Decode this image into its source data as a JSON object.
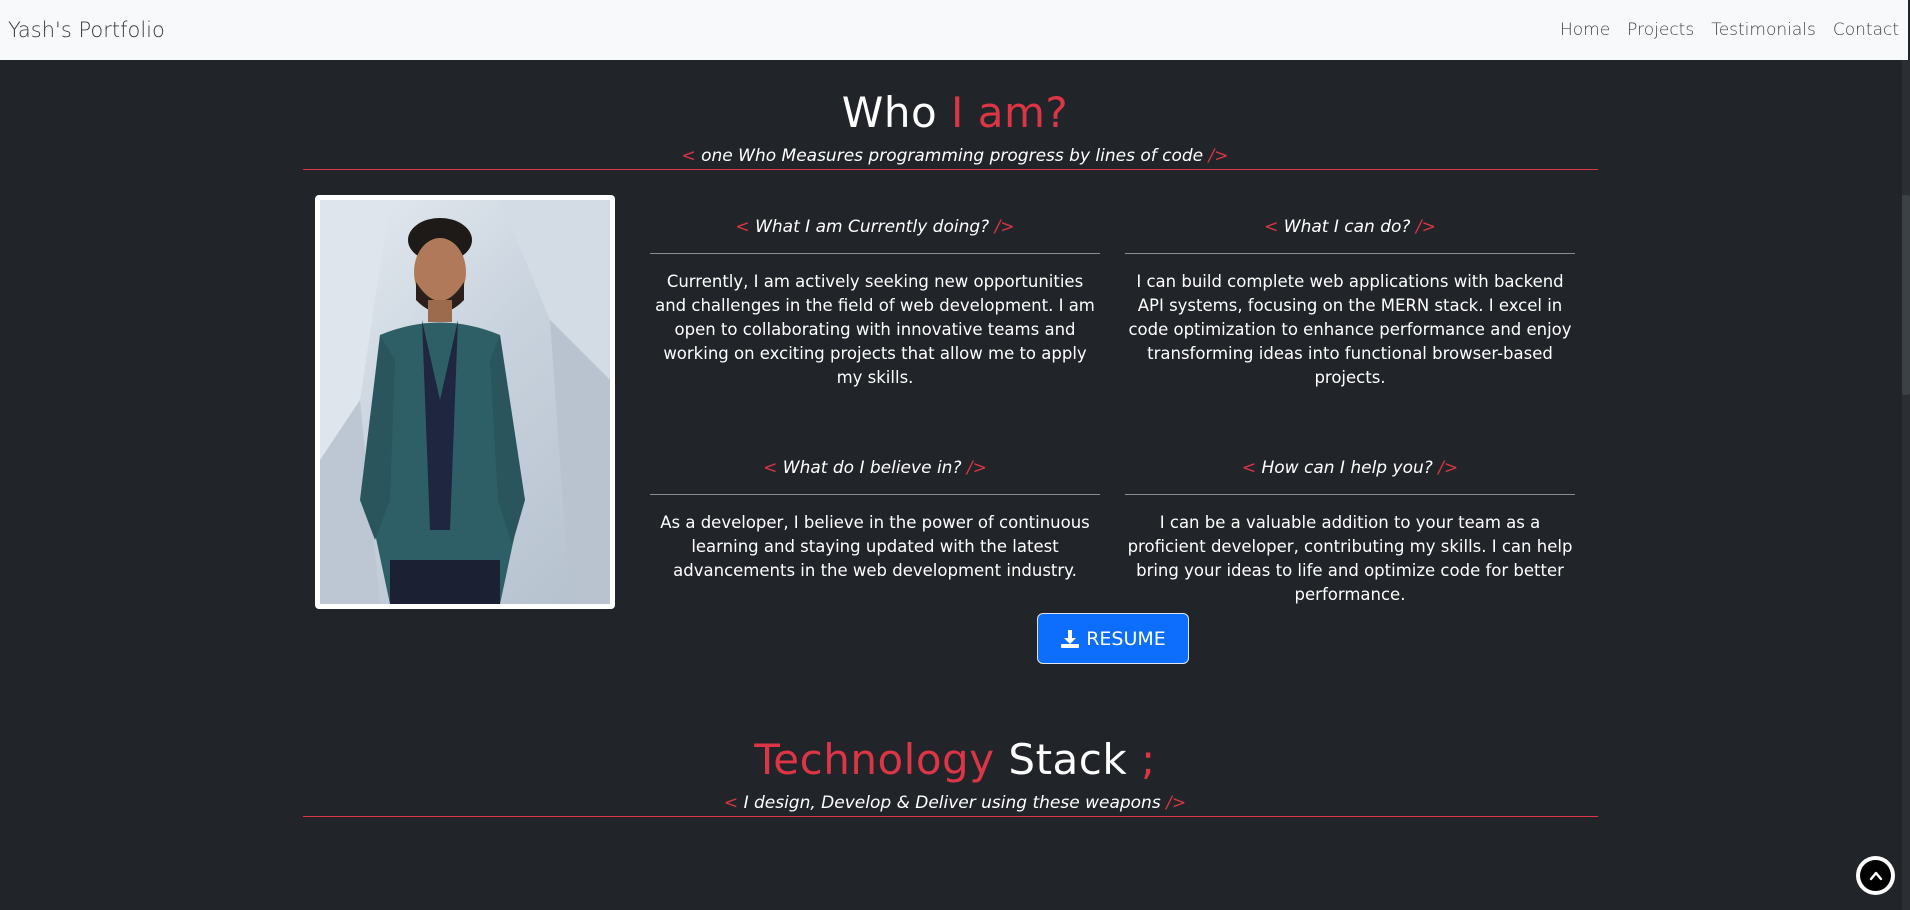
{
  "nav": {
    "brand": "Yash's Portfolio",
    "links": [
      "Home",
      "Projects",
      "Testimonials",
      "Contact"
    ]
  },
  "about": {
    "title_a": "Who",
    "title_b": "I am?",
    "tag_open": "<",
    "tag_close": "/>",
    "subtitle": "one Who Measures programming progress by lines of code",
    "cards": [
      {
        "heading": "What I am Currently doing?",
        "body": "Currently, I am actively seeking new opportunities and challenges in the field of web development. I am open to collaborating with innovative teams and working on exciting projects that allow me to apply my skills."
      },
      {
        "heading": "What I can do?",
        "body": "I can build complete web applications with backend API systems, focusing on the MERN stack. I excel in code optimization to enhance performance and enjoy transforming ideas into functional browser-based projects."
      },
      {
        "heading": "What do I believe in?",
        "body": "As a developer, I believe in the power of continuous learning and staying updated with the latest advancements in the web development industry."
      },
      {
        "heading": "How can I help you?",
        "body": "I can be a valuable addition to your team as a proficient developer, contributing my skills. I can help bring your ideas to life and optimize code for better performance."
      }
    ],
    "resume_label": "RESUME"
  },
  "tech": {
    "title_a": "Technology",
    "title_b": "Stack",
    "title_c": ";",
    "subtitle": "I design, Develop & Deliver using these weapons"
  },
  "icons": {
    "download": "download-icon",
    "up": "chevron-up-icon"
  },
  "colors": {
    "accent": "#dc3545",
    "background": "#212529",
    "navbar": "#f8f9fa",
    "button": "#0d6efd"
  }
}
